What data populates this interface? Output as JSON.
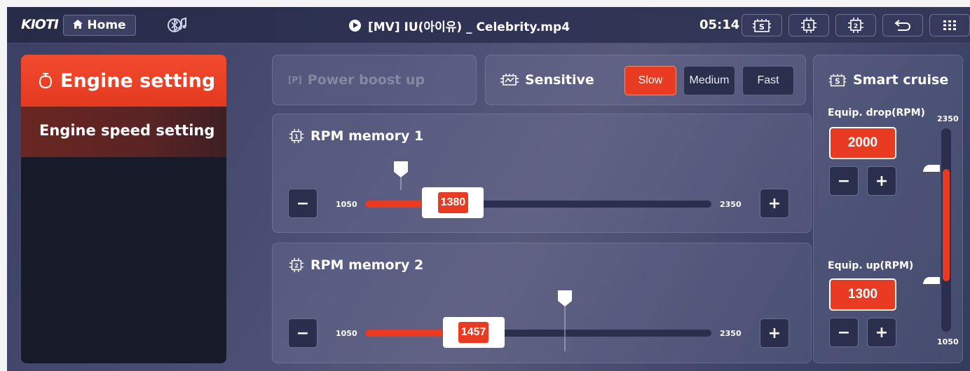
{
  "topbar": {
    "logo": "KIOTI",
    "home_label": "Home",
    "home_icon": "home-icon",
    "bluetooth_icon": "bluetooth-icon",
    "media_title": "[MV] IU(아이유) _ Celebrity.mp4",
    "clock": "05:14",
    "buttons": [
      "smart-cruise-icon",
      "rpm-memory-1-icon",
      "rpm-memory-2-icon",
      "back-icon",
      "menu-grid-icon"
    ]
  },
  "sidebar": {
    "active_label": "Engine setting",
    "items": [
      {
        "label": "Engine speed setting"
      }
    ]
  },
  "power_boost": {
    "label": "Power boost up",
    "badge": "[P]",
    "enabled": false
  },
  "sensitive": {
    "label": "Sensitive",
    "options": [
      "Slow",
      "Medium",
      "Fast"
    ],
    "selected": "Slow"
  },
  "rpm_memory_1": {
    "title": "RPM memory 1",
    "min": "1050",
    "max": "2350",
    "value": "1380",
    "value_num": 1380,
    "min_num": 1050,
    "max_num": 2350,
    "marker_num": 1185
  },
  "rpm_memory_2": {
    "title": "RPM memory 2",
    "min": "1050",
    "max": "2350",
    "value": "1457",
    "value_num": 1457,
    "min_num": 1050,
    "max_num": 2350,
    "marker_num": 1800
  },
  "smart_cruise": {
    "title": "Smart cruise",
    "drop_label": "Equip. drop(RPM)",
    "drop_value": "2000",
    "up_label": "Equip. up(RPM)",
    "up_value": "1300",
    "scale_max": "2350",
    "scale_min": "1050"
  },
  "colors": {
    "accent": "#e83b22",
    "panel": "#2a2f4e"
  }
}
